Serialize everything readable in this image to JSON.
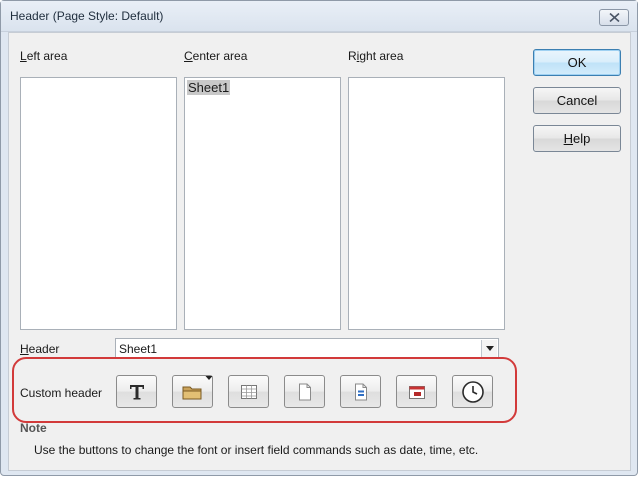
{
  "window": {
    "title": "Header (Page Style: Default)"
  },
  "areas": {
    "left": {
      "label_prefix": "",
      "label_key": "L",
      "label_rest": "eft area",
      "content": ""
    },
    "center": {
      "label_prefix": "",
      "label_key": "C",
      "label_rest": "enter area",
      "content": "Sheet1"
    },
    "right": {
      "label_prefix": "R",
      "label_key": "i",
      "label_rest": "ght area",
      "content": ""
    }
  },
  "buttons": {
    "ok": "OK",
    "cancel": "Cancel",
    "help_key": "H",
    "help_rest": "elp"
  },
  "header": {
    "label_key": "H",
    "label_rest": "eader",
    "selected": "Sheet1"
  },
  "custom_header": {
    "label": "Custom header",
    "tools": [
      {
        "icon": "text-attributes-icon"
      },
      {
        "icon": "file-name-icon"
      },
      {
        "icon": "sheet-name-icon"
      },
      {
        "icon": "page-icon"
      },
      {
        "icon": "pages-icon"
      },
      {
        "icon": "date-icon"
      },
      {
        "icon": "time-icon"
      }
    ]
  },
  "note": {
    "label": "Note",
    "text": "Use the buttons to change the font or insert field commands such as date, time, etc."
  },
  "colors": {
    "highlight": "#d23a3a",
    "default_button": "#3c7fb1"
  }
}
